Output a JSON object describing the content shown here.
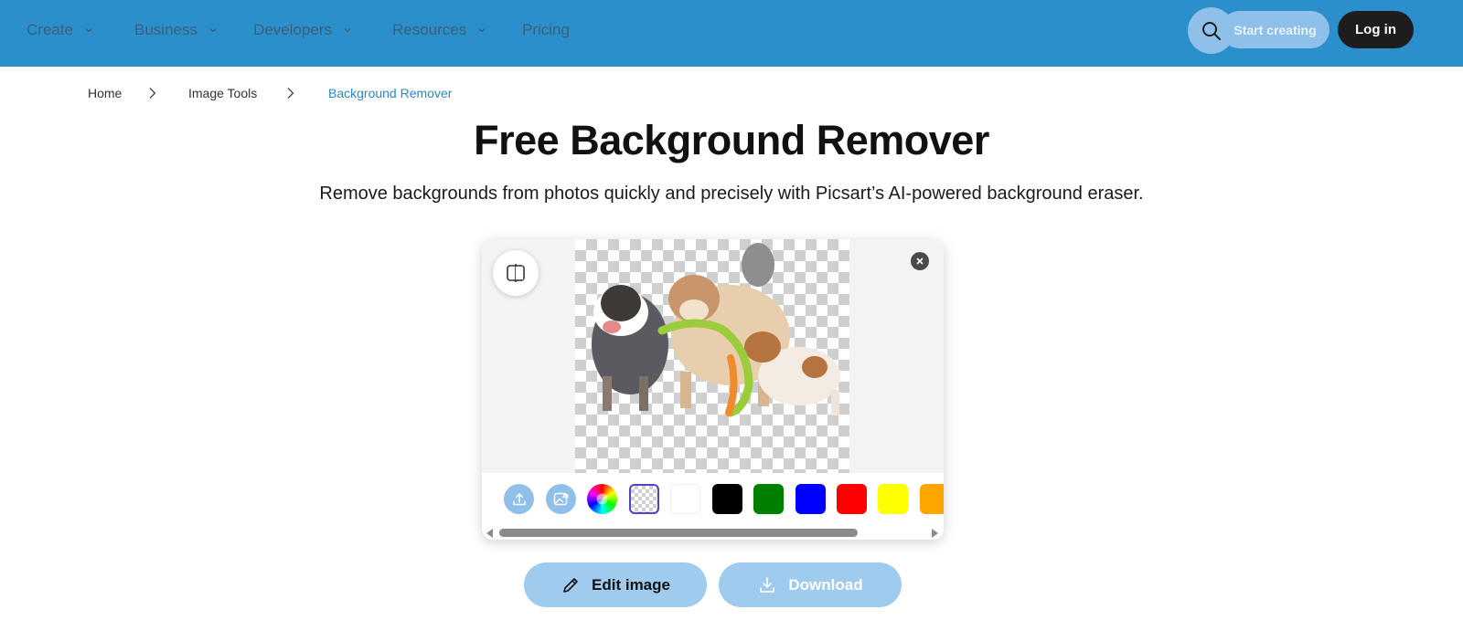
{
  "nav": {
    "items": [
      {
        "label": "Create",
        "has_dropdown": true
      },
      {
        "label": "Business",
        "has_dropdown": true
      },
      {
        "label": "Developers",
        "has_dropdown": true
      },
      {
        "label": "Resources",
        "has_dropdown": true
      },
      {
        "label": "Pricing",
        "has_dropdown": false
      }
    ],
    "search_icon": "search-icon",
    "start_label": "Start creating",
    "login_label": "Log in"
  },
  "breadcrumb": [
    "Home",
    "Image Tools",
    "Background Remover"
  ],
  "hero": {
    "title": "Free Background Remover",
    "subtitle": "Remove backgrounds from photos quickly and precisely with Picsart’s AI-powered background eraser."
  },
  "editor": {
    "compare_icon": "compare-split-icon",
    "close_icon": "close-icon",
    "tools": [
      "upload-icon",
      "ai-image-icon",
      "color-wheel-icon"
    ],
    "swatches": [
      {
        "name": "transparent",
        "color": "transparent",
        "selected": true
      },
      {
        "name": "white",
        "color": "#ffffff"
      },
      {
        "name": "black",
        "color": "#000000"
      },
      {
        "name": "green",
        "color": "#008000"
      },
      {
        "name": "blue",
        "color": "#0000ff"
      },
      {
        "name": "red",
        "color": "#ff0000"
      },
      {
        "name": "yellow",
        "color": "#ffff00"
      },
      {
        "name": "orange",
        "color": "#ffa500"
      }
    ]
  },
  "actions": {
    "edit_label": "Edit image",
    "download_label": "Download"
  },
  "colors": {
    "nav_bg": "#2b8fcc",
    "accent": "#2b86c8",
    "button_light": "#9ecbee"
  }
}
